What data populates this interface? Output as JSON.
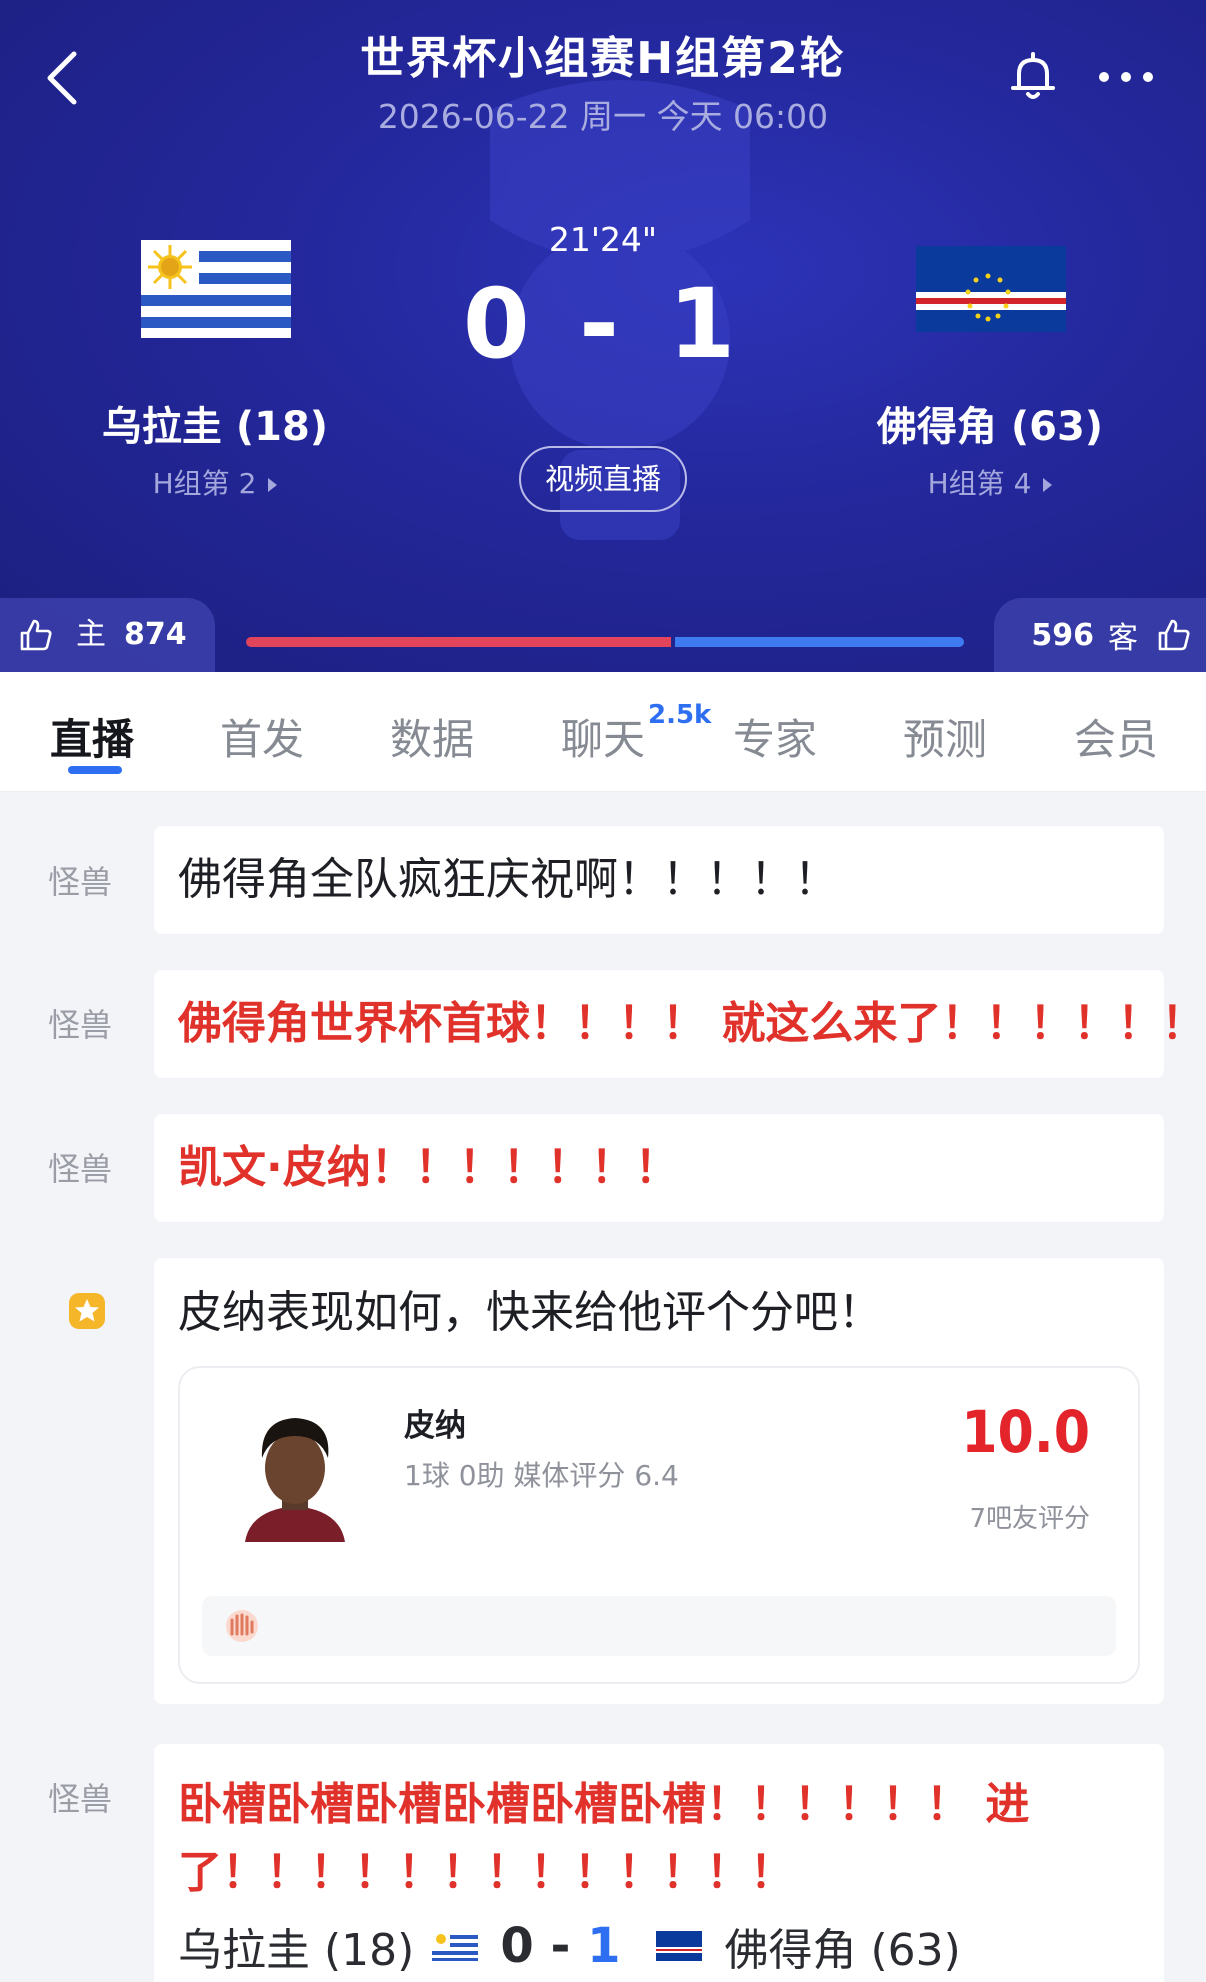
{
  "header": {
    "title": "世界杯小组赛H组第2轮",
    "subtitle": "2026-06-22 周一 今天 06:00",
    "match_time": "21'24\"",
    "score": "0 - 1",
    "video_button": "视频直播"
  },
  "home": {
    "name": "乌拉圭 (18)",
    "rank": "H组第 2",
    "vote_label": "主",
    "votes": "874"
  },
  "away": {
    "name": "佛得角 (63)",
    "rank": "H组第 4",
    "vote_label": "客",
    "votes": "596"
  },
  "vote_share_home": 0.595,
  "tabs": [
    {
      "label": "直播"
    },
    {
      "label": "首发"
    },
    {
      "label": "数据"
    },
    {
      "label": "聊天",
      "badge": "2.5k"
    },
    {
      "label": "专家"
    },
    {
      "label": "预测"
    },
    {
      "label": "会员"
    }
  ],
  "feed": [
    {
      "author": "怪兽",
      "text": "佛得角全队疯狂庆祝啊！！！！！"
    },
    {
      "author": "怪兽",
      "text": "佛得角世界杯首球！！！！  就这么来了！！！！！！"
    },
    {
      "author": "怪兽",
      "text": "凯文·皮纳！！！！！！！"
    },
    {
      "text": "皮纳表现如何，快来给他评个分吧！"
    },
    {
      "author": "怪兽",
      "line1": "卧槽卧槽卧槽卧槽卧槽卧槽！！！！！！  进",
      "line2": "了！！！！！！！！！！！！！"
    }
  ],
  "rating_card": {
    "player": "皮纳",
    "stats": "1球 0助   媒体评分 6.4",
    "score": "10.0",
    "count": "7吧友评分"
  },
  "summary": {
    "home": "乌拉圭 (18)",
    "home_score": "0",
    "dash": "-",
    "away_score": "1",
    "away": "佛得角 (63)"
  },
  "colors": {
    "header_bg": "#23279a",
    "accent_blue": "#2e6ff2",
    "alert_red": "#e0322b",
    "home_bar": "#e2445c",
    "away_bar": "#3f7bf0"
  }
}
